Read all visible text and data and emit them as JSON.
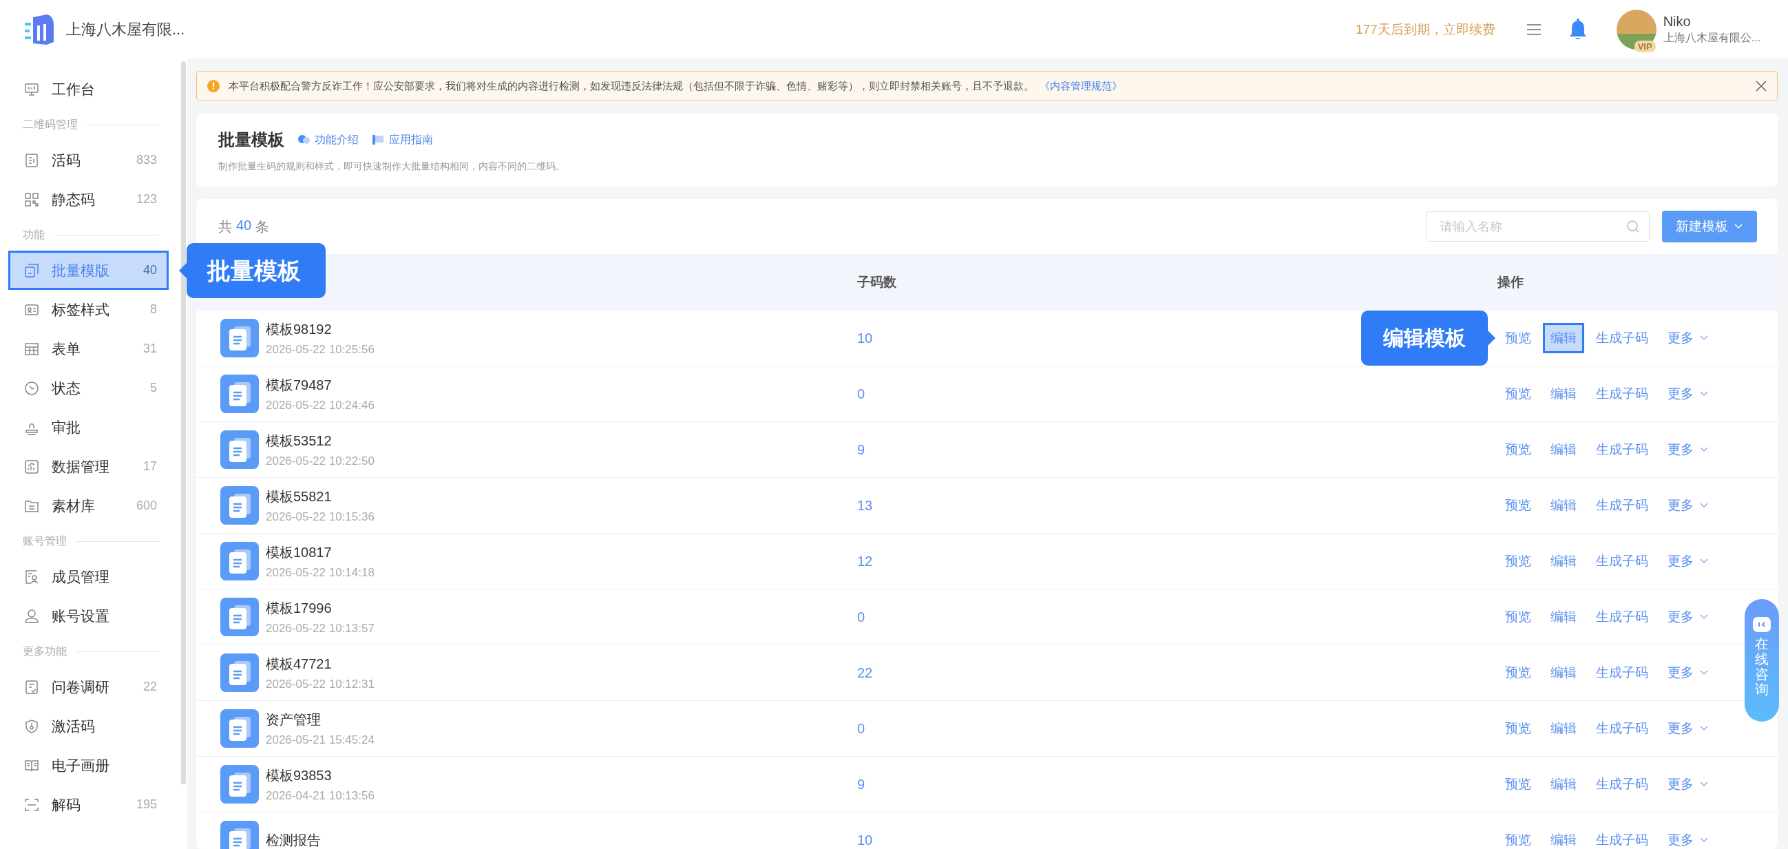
{
  "topbar": {
    "company": "上海八木屋有限...",
    "expiry": "177天后到期，立即续费",
    "user": {
      "name": "Niko",
      "badge": "VIP",
      "company": "上海八木屋有限公..."
    }
  },
  "sidebar": {
    "items": [
      {
        "kind": "item",
        "label": "工作台",
        "selected": false
      },
      {
        "kind": "section",
        "label": "二维码管理"
      },
      {
        "kind": "item",
        "label": "活码",
        "count": "833",
        "selected": false
      },
      {
        "kind": "item",
        "label": "静态码",
        "count": "123",
        "selected": false
      },
      {
        "kind": "section",
        "label": "功能"
      },
      {
        "kind": "item",
        "label": "批量模版",
        "count": "40",
        "selected": true,
        "callout": "批量模板"
      },
      {
        "kind": "item",
        "label": "标签样式",
        "count": "8",
        "selected": false
      },
      {
        "kind": "item",
        "label": "表单",
        "count": "31",
        "selected": false
      },
      {
        "kind": "item",
        "label": "状态",
        "count": "5",
        "selected": false
      },
      {
        "kind": "item",
        "label": "审批",
        "selected": false
      },
      {
        "kind": "item",
        "label": "数据管理",
        "count": "17",
        "selected": false
      },
      {
        "kind": "item",
        "label": "素材库",
        "count": "600",
        "selected": false
      },
      {
        "kind": "section",
        "label": "账号管理"
      },
      {
        "kind": "item",
        "label": "成员管理",
        "selected": false
      },
      {
        "kind": "item",
        "label": "账号设置",
        "selected": false
      },
      {
        "kind": "section",
        "label": "更多功能"
      },
      {
        "kind": "item",
        "label": "问卷调研",
        "count": "22",
        "selected": false
      },
      {
        "kind": "item",
        "label": "激活码",
        "selected": false
      },
      {
        "kind": "item",
        "label": "电子画册",
        "selected": false
      },
      {
        "kind": "item",
        "label": "解码",
        "count": "195",
        "selected": false
      }
    ]
  },
  "notice": {
    "text": "本平台积极配合警方反诈工作！应公安部要求，我们将对生成的内容进行检测，如发现违反法律法规（包括但不限于诈骗、色情、赌彩等），则立即封禁相关账号，且不予退款。",
    "link": "《内容管理规范》"
  },
  "header": {
    "title": "批量模板",
    "links": [
      "功能介绍",
      "应用指南"
    ],
    "description": "制作批量生码的规则和样式，即可快速制作大批量结构相同，内容不同的二维码。"
  },
  "toolbar": {
    "total_prefix": "共",
    "total_count": "40",
    "total_suffix": "条",
    "search_placeholder": "请输入名称",
    "new_button": "新建模板"
  },
  "table": {
    "columns": [
      "子码数",
      "操作"
    ],
    "rows": [
      {
        "name": "模板98192",
        "date": "2026-05-22 10:25:56",
        "count": "10",
        "actions": [
          {
            "kind": "link",
            "label": "预览",
            "highlighted": false
          },
          {
            "kind": "link",
            "label": "编辑",
            "highlighted": true,
            "callout": "编辑模板"
          },
          {
            "kind": "link",
            "label": "生成子码",
            "highlighted": false
          },
          {
            "kind": "dropdown",
            "label": "更多",
            "highlighted": false
          }
        ]
      },
      {
        "name": "模板79487",
        "date": "2026-05-22 10:24:46",
        "count": "0",
        "actions": [
          {
            "kind": "link",
            "label": "预览",
            "highlighted": false
          },
          {
            "kind": "link",
            "label": "编辑",
            "highlighted": false
          },
          {
            "kind": "link",
            "label": "生成子码",
            "highlighted": false
          },
          {
            "kind": "dropdown",
            "label": "更多",
            "highlighted": false
          }
        ]
      },
      {
        "name": "模板53512",
        "date": "2026-05-22 10:22:50",
        "count": "9",
        "actions": [
          {
            "kind": "link",
            "label": "预览",
            "highlighted": false
          },
          {
            "kind": "link",
            "label": "编辑",
            "highlighted": false
          },
          {
            "kind": "link",
            "label": "生成子码",
            "highlighted": false
          },
          {
            "kind": "dropdown",
            "label": "更多",
            "highlighted": false
          }
        ]
      },
      {
        "name": "模板55821",
        "date": "2026-05-22 10:15:36",
        "count": "13",
        "actions": [
          {
            "kind": "link",
            "label": "预览",
            "highlighted": false
          },
          {
            "kind": "link",
            "label": "编辑",
            "highlighted": false
          },
          {
            "kind": "link",
            "label": "生成子码",
            "highlighted": false
          },
          {
            "kind": "dropdown",
            "label": "更多",
            "highlighted": false
          }
        ]
      },
      {
        "name": "模板10817",
        "date": "2026-05-22 10:14:18",
        "count": "12",
        "actions": [
          {
            "kind": "link",
            "label": "预览",
            "highlighted": false
          },
          {
            "kind": "link",
            "label": "编辑",
            "highlighted": false
          },
          {
            "kind": "link",
            "label": "生成子码",
            "highlighted": false
          },
          {
            "kind": "dropdown",
            "label": "更多",
            "highlighted": false
          }
        ]
      },
      {
        "name": "模板17996",
        "date": "2026-05-22 10:13:57",
        "count": "0",
        "actions": [
          {
            "kind": "link",
            "label": "预览",
            "highlighted": false
          },
          {
            "kind": "link",
            "label": "编辑",
            "highlighted": false
          },
          {
            "kind": "link",
            "label": "生成子码",
            "highlighted": false
          },
          {
            "kind": "dropdown",
            "label": "更多",
            "highlighted": false
          }
        ]
      },
      {
        "name": "模板47721",
        "date": "2026-05-22 10:12:31",
        "count": "22",
        "actions": [
          {
            "kind": "link",
            "label": "预览",
            "highlighted": false
          },
          {
            "kind": "link",
            "label": "编辑",
            "highlighted": false
          },
          {
            "kind": "link",
            "label": "生成子码",
            "highlighted": false
          },
          {
            "kind": "dropdown",
            "label": "更多",
            "highlighted": false
          }
        ]
      },
      {
        "name": "资产管理",
        "date": "2026-05-21 15:45:24",
        "count": "0",
        "actions": [
          {
            "kind": "link",
            "label": "预览",
            "highlighted": false
          },
          {
            "kind": "link",
            "label": "编辑",
            "highlighted": false
          },
          {
            "kind": "link",
            "label": "生成子码",
            "highlighted": false
          },
          {
            "kind": "dropdown",
            "label": "更多",
            "highlighted": false
          }
        ]
      },
      {
        "name": "模板93853",
        "date": "2026-04-21 10:13:56",
        "count": "9",
        "actions": [
          {
            "kind": "link",
            "label": "预览",
            "highlighted": false
          },
          {
            "kind": "link",
            "label": "编辑",
            "highlighted": false
          },
          {
            "kind": "link",
            "label": "生成子码",
            "highlighted": false
          },
          {
            "kind": "dropdown",
            "label": "更多",
            "highlighted": false
          }
        ]
      },
      {
        "name": "检测报告",
        "count": "10",
        "actions": [
          {
            "kind": "link",
            "label": "预览",
            "highlighted": false
          },
          {
            "kind": "link",
            "label": "编辑",
            "highlighted": false
          },
          {
            "kind": "link",
            "label": "生成子码",
            "highlighted": false
          },
          {
            "kind": "dropdown",
            "label": "更多",
            "highlighted": false
          }
        ]
      }
    ]
  },
  "consult": {
    "label": "在线咨询"
  }
}
